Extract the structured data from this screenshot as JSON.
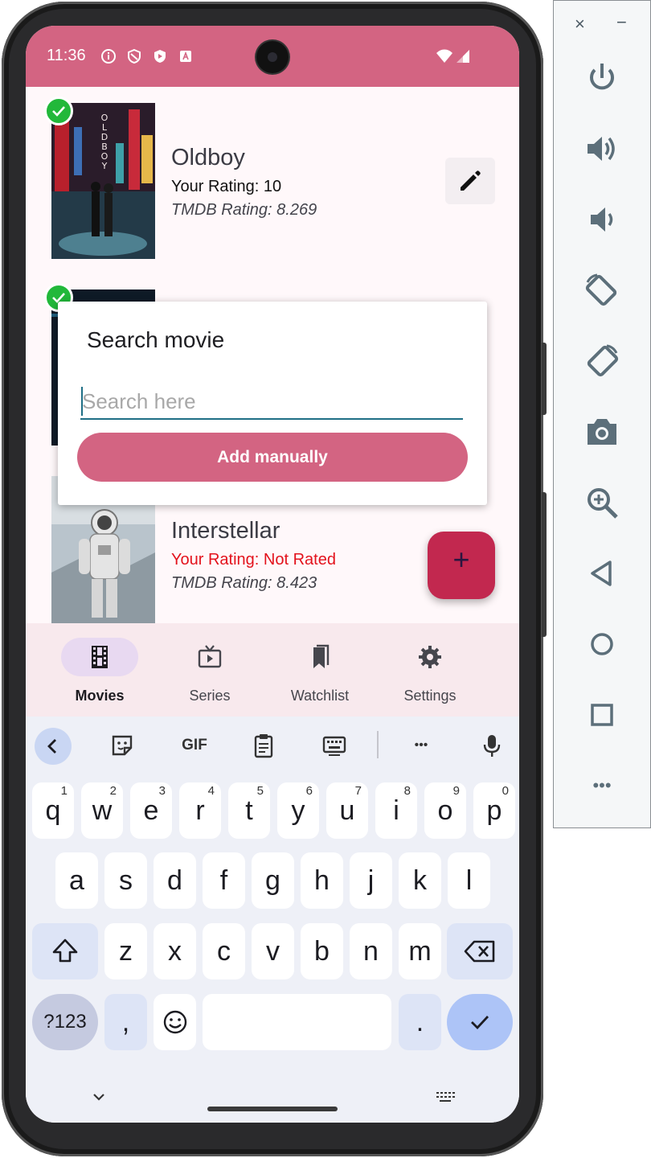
{
  "status_bar": {
    "time": "11:36"
  },
  "movies": [
    {
      "title": "Oldboy",
      "your_rating": "Your Rating: 10",
      "tmdb_rating": "TMDB Rating: 8.269",
      "watched": true
    },
    {
      "title": "",
      "your_rating": "",
      "tmdb_rating": "",
      "watched": true
    },
    {
      "title": "Interstellar",
      "your_rating": "Your Rating: Not Rated",
      "tmdb_rating": "TMDB Rating: 8.423",
      "watched": false
    }
  ],
  "poster_1_text": "OLDBOY",
  "dialog": {
    "title": "Search movie",
    "search_placeholder": "Search here",
    "search_value": "",
    "add_manually_label": "Add manually"
  },
  "fab_label": "+",
  "bottom_nav": {
    "items": [
      {
        "label": "Movies",
        "icon": "film-icon",
        "active": true
      },
      {
        "label": "Series",
        "icon": "tv-play-icon",
        "active": false
      },
      {
        "label": "Watchlist",
        "icon": "bookmarks-icon",
        "active": false
      },
      {
        "label": "Settings",
        "icon": "gear-icon",
        "active": false
      }
    ]
  },
  "keyboard": {
    "toolbar": {
      "gif_label": "GIF",
      "more_label": "•••"
    },
    "row1": [
      {
        "k": "q",
        "n": "1"
      },
      {
        "k": "w",
        "n": "2"
      },
      {
        "k": "e",
        "n": "3"
      },
      {
        "k": "r",
        "n": "4"
      },
      {
        "k": "t",
        "n": "5"
      },
      {
        "k": "y",
        "n": "6"
      },
      {
        "k": "u",
        "n": "7"
      },
      {
        "k": "i",
        "n": "8"
      },
      {
        "k": "o",
        "n": "9"
      },
      {
        "k": "p",
        "n": "0"
      }
    ],
    "row2": [
      "a",
      "s",
      "d",
      "f",
      "g",
      "h",
      "j",
      "k",
      "l"
    ],
    "row3": [
      "z",
      "x",
      "c",
      "v",
      "b",
      "n",
      "m"
    ],
    "row4": {
      "symbols": "?123",
      "comma": ",",
      "period": "."
    }
  },
  "colors": {
    "accent": "#d36482",
    "fab": "#c2284f",
    "watched_badge": "#22b83a",
    "not_rated": "#e3121c",
    "input_underline": "#1f6f86"
  },
  "emulator_panel": {
    "close_label": "×",
    "minimize_label": "−",
    "more_label": "•••",
    "buttons": [
      "power-icon",
      "volume-up-icon",
      "volume-down-icon",
      "rotate-left-icon",
      "rotate-right-icon",
      "camera-icon",
      "zoom-icon",
      "back-icon",
      "home-icon",
      "overview-icon",
      "more-icon"
    ]
  }
}
